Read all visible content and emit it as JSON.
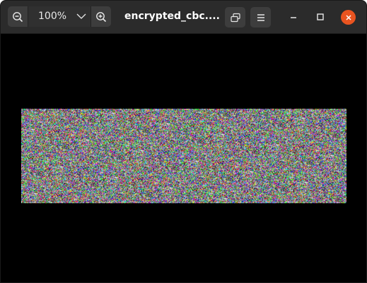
{
  "window": {
    "title": "encrypted_cbc....",
    "accent_close": "#e95420"
  },
  "toolbar": {
    "zoom_out_icon": "zoom-out-icon",
    "zoom_level": "100%",
    "zoom_dropdown_icon": "chevron-down-icon",
    "zoom_in_icon": "zoom-in-icon",
    "fullscreen_icon": "fullscreen-icon",
    "menu_icon": "hamburger-menu-icon"
  },
  "window_controls": {
    "minimize_icon": "minimize-icon",
    "maximize_icon": "maximize-icon",
    "close_icon": "close-icon"
  },
  "viewer": {
    "background": "#000000",
    "image_description_kind": "random-color-noise"
  }
}
